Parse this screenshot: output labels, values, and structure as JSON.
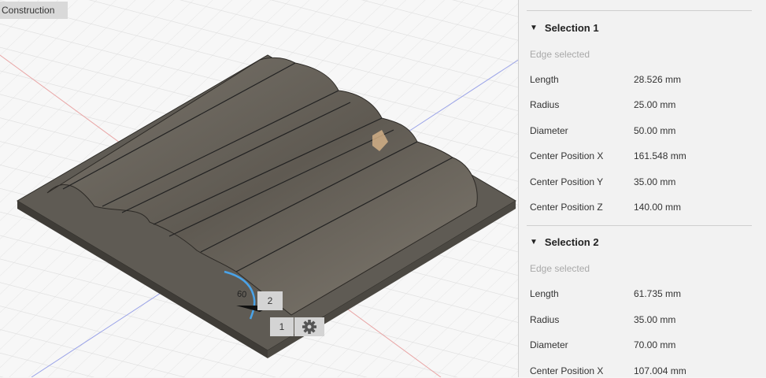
{
  "viewport": {
    "construction_label": "Construction",
    "dimension_text": "60",
    "marker_2": "2",
    "marker_1": "1",
    "gear_icon": "gear-icon"
  },
  "panel": {
    "selections": [
      {
        "title": "Selection 1",
        "subtitle": "Edge selected",
        "rows": [
          {
            "label": "Length",
            "value": "28.526 mm"
          },
          {
            "label": "Radius",
            "value": "25.00 mm"
          },
          {
            "label": "Diameter",
            "value": "50.00 mm"
          },
          {
            "label": "Center Position X",
            "value": "161.548 mm"
          },
          {
            "label": "Center Position Y",
            "value": "35.00 mm"
          },
          {
            "label": "Center Position Z",
            "value": "140.00 mm"
          }
        ]
      },
      {
        "title": "Selection 2",
        "subtitle": "Edge selected",
        "rows": [
          {
            "label": "Length",
            "value": "61.735 mm"
          },
          {
            "label": "Radius",
            "value": "35.00 mm"
          },
          {
            "label": "Diameter",
            "value": "70.00 mm"
          },
          {
            "label": "Center Position X",
            "value": "107.004 mm"
          }
        ]
      }
    ]
  },
  "colors": {
    "model_body": "#6b665e",
    "model_dark": "#4a463f",
    "selection_arc": "#4aa3e8",
    "grid_line": "#dddddd",
    "axis_red": "#e8a0a0",
    "axis_blue": "#8f9be6"
  }
}
